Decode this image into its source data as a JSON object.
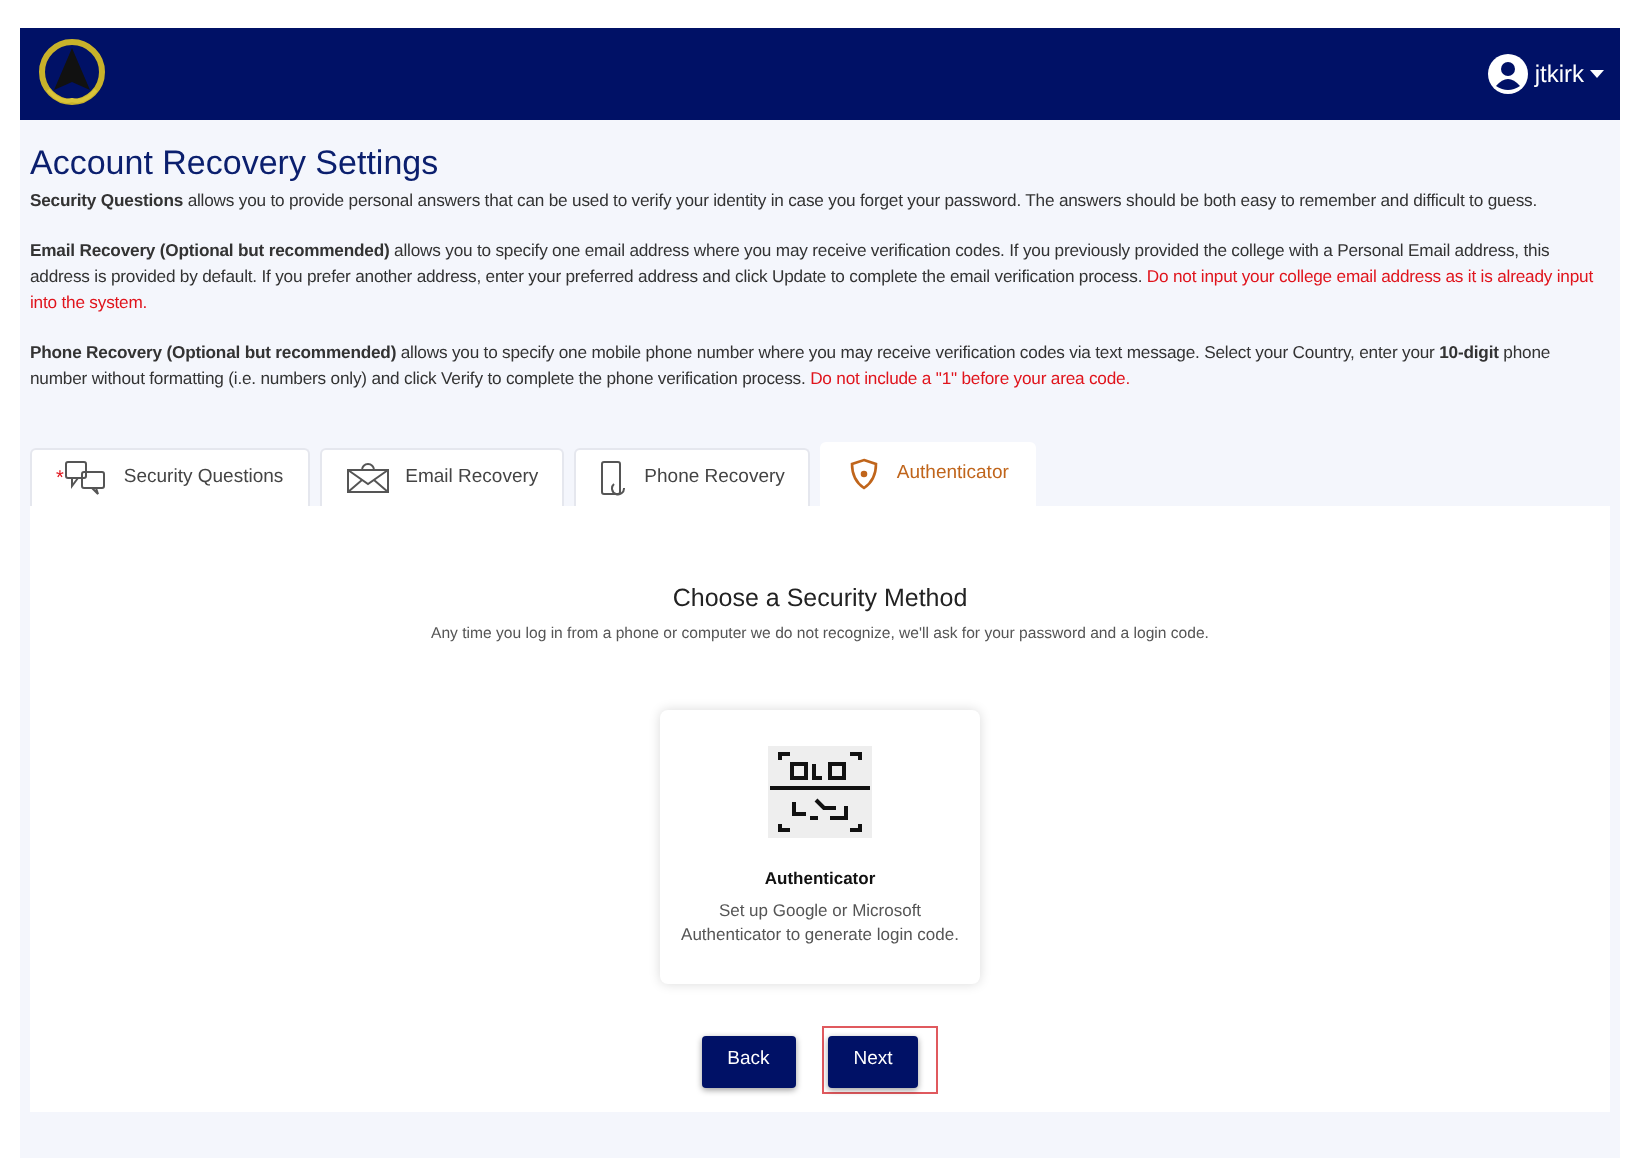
{
  "navbar": {
    "user": "jtkirk"
  },
  "page": {
    "title": "Account Recovery Settings",
    "paragraphs": [
      {
        "text": "**Security Questions** allows you to provide personal answers that can be used to verify your identity in case you forget your password. The answers should be both easy to remember and difficult to guess."
      },
      {
        "text": "**Email Recovery (Optional but recommended)** allows you to specify one email address where you may receive verification codes. If you previously provided the college with a Personal Email address, this address is provided by default. If you prefer another address, enter your preferred address and click Update to complete the email verification process.",
        "warning": "Do not input your college email address as it is already input into the system."
      },
      {
        "text": "**Phone Recovery (Optional but recommended)** allows you to specify one mobile phone number where you may receive verification codes via text message. Select your Country, enter your **10-digit** phone number without formatting (i.e. numbers only) and click Verify to complete the phone verification process.",
        "warning": "Do not include a \"1\" before your area code."
      }
    ]
  },
  "tabs": [
    {
      "label": "Security Questions",
      "kind": "questions",
      "required_mark": "*",
      "selected": false
    },
    {
      "label": "Email Recovery",
      "kind": "email",
      "selected": false
    },
    {
      "label": "Phone Recovery",
      "kind": "phone",
      "selected": false
    },
    {
      "label": "Authenticator",
      "kind": "shield",
      "selected": true
    }
  ],
  "panel": {
    "heading": "Choose a Security Method",
    "subheading": "Any time you log in from a phone or computer we do not recognize, we'll ask for your password and a login code.",
    "method": {
      "title": "Authenticator",
      "description": "Set up Google or Microsoft Authenticator to generate login code."
    },
    "buttons": [
      {
        "label": "Back",
        "highlighted": false
      },
      {
        "label": "Next",
        "highlighted": true
      }
    ]
  }
}
